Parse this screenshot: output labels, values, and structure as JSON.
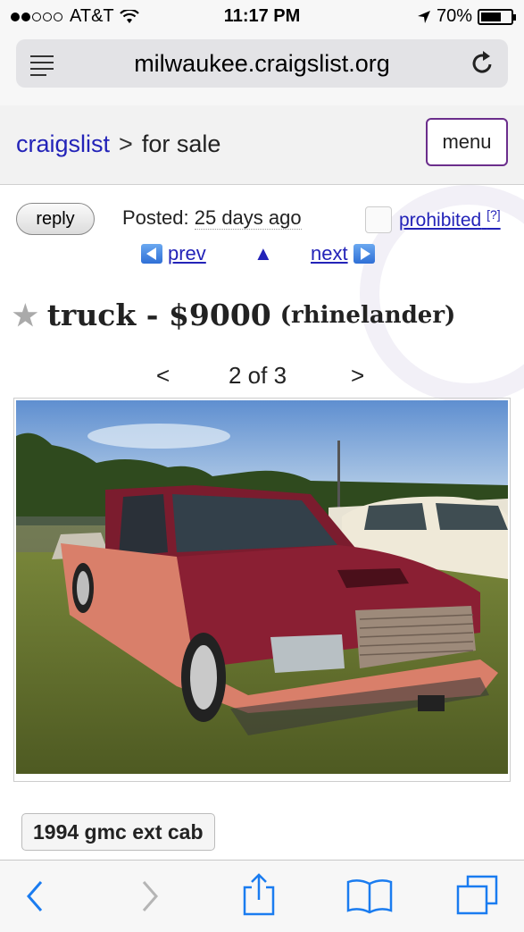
{
  "status_bar": {
    "carrier": "AT&T",
    "time": "11:17 PM",
    "battery": "70%",
    "battery_level": 0.7,
    "signal_icon": "signal-dots-icon",
    "wifi_icon": "wifi-icon",
    "location_icon": "location-arrow-icon"
  },
  "browser": {
    "url": "milwaukee.craigslist.org",
    "reader_icon": "reader-icon",
    "reload_icon": "reload-icon"
  },
  "header": {
    "site": "craigslist",
    "separator": ">",
    "section": "for sale",
    "menu_label": "menu"
  },
  "posting": {
    "reply_label": "reply",
    "posted_label": "Posted:",
    "posted_ago": "25 days ago",
    "prohibited_label": "prohibited",
    "prohibited_help": "[?]",
    "prev_label": "prev",
    "up_label": "▲",
    "next_label": "next",
    "title": "truck - $9000",
    "location": "(rhinelander)",
    "pager_prev": "<",
    "pager_count": "2 of 3",
    "pager_next": ">",
    "attribute": "1994 gmc ext cab"
  },
  "toolbar": {
    "back_icon": "back-icon",
    "forward_icon": "forward-icon",
    "share_icon": "share-icon",
    "bookmarks_icon": "bookmarks-icon",
    "tabs_icon": "tabs-icon"
  },
  "colors": {
    "link": "#2323b8",
    "menu_border": "#6b2e8c",
    "ios_blue": "#1a7cf0"
  }
}
